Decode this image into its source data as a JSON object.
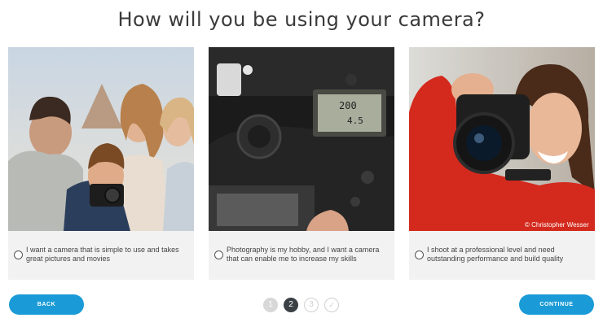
{
  "page": {
    "title": "How will you be using your camera?"
  },
  "options": [
    {
      "text": "I want a camera that is simple to use and takes great pictures and movies",
      "image": "family-with-child-camera-photo"
    },
    {
      "text": "Photography is my hobby, and I want a camera that can enable me to increase my skills",
      "image": "dslr-closeup-photo"
    },
    {
      "text": "I shoot at a professional level and need outstanding performance and build quality",
      "image": "woman-with-camera-photo",
      "credit": "© Christopher Wesser"
    }
  ],
  "nav": {
    "back_label": "BACK",
    "continue_label": "CONTINUE",
    "steps": [
      "1",
      "2",
      "3",
      "✓"
    ],
    "current_step": 2
  },
  "colors": {
    "accent": "#1a9bd7",
    "active_step": "#3b4045",
    "card_bg": "#f2f2f2"
  }
}
